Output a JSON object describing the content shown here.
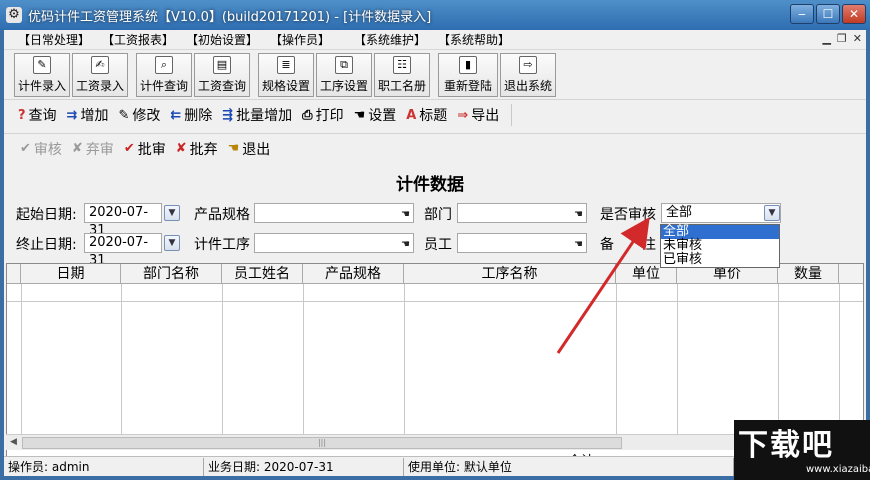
{
  "window": {
    "title": "优码计件工资管理系统【V10.0】(build20171201) - [计件数据录入]"
  },
  "menu": [
    "【日常处理】",
    "【工资报表】",
    "【初始设置】",
    "【操作员】",
    "【系统维护】",
    "【系统帮助】"
  ],
  "big_toolbar": [
    "计件录入",
    "工资录入",
    "计件查询",
    "工资查询",
    "规格设置",
    "工序设置",
    "职工名册",
    "重新登陆",
    "退出系统"
  ],
  "toolbar_row1": [
    {
      "label": "查询",
      "icon": "query-icon"
    },
    {
      "label": "增加",
      "icon": "add-icon"
    },
    {
      "label": "修改",
      "icon": "edit-icon"
    },
    {
      "label": "删除",
      "icon": "delete-icon"
    },
    {
      "label": "批量增加",
      "icon": "batch-add-icon"
    },
    {
      "label": "打印",
      "icon": "print-icon"
    },
    {
      "label": "设置",
      "icon": "settings-icon"
    },
    {
      "label": "标题",
      "icon": "title-icon"
    },
    {
      "label": "导出",
      "icon": "export-icon"
    }
  ],
  "toolbar_row2": [
    {
      "label": "审核",
      "icon": "check-icon",
      "enabled": false
    },
    {
      "label": "弃审",
      "icon": "reject-icon",
      "enabled": false
    },
    {
      "label": "批审",
      "icon": "batch-check-icon",
      "enabled": true
    },
    {
      "label": "批弃",
      "icon": "batch-reject-icon",
      "enabled": true
    },
    {
      "label": "退出",
      "icon": "exit-icon",
      "enabled": true
    }
  ],
  "form": {
    "title": "计件数据",
    "start_date_label": "起始日期:",
    "start_date": "2020-07-31",
    "end_date_label": "终止日期:",
    "end_date": "2020-07-31",
    "spec_label": "产品规格",
    "process_label": "计件工序",
    "dept_label": "部门",
    "employee_label": "员工",
    "audit_label": "是否审核",
    "audit_value": "全部",
    "note_label": "备　　注"
  },
  "audit_options": [
    "全部",
    "未审核",
    "已审核"
  ],
  "grid": {
    "columns": [
      "日期",
      "部门名称",
      "员工姓名",
      "产品规格",
      "工序名称",
      "单位",
      "单价",
      "数量"
    ],
    "total_label": "合计:"
  },
  "status": {
    "operator": "操作员: admin",
    "business_date": "业务日期: 2020-07-31",
    "unit": "使用单位: 默认单位"
  },
  "watermark": {
    "big": "下载吧",
    "small": "www.xiazaiba.com"
  },
  "colors": {
    "titlebar": "#2e6db0",
    "selection": "#2f6fd0",
    "annotation": "#d22a2a"
  }
}
